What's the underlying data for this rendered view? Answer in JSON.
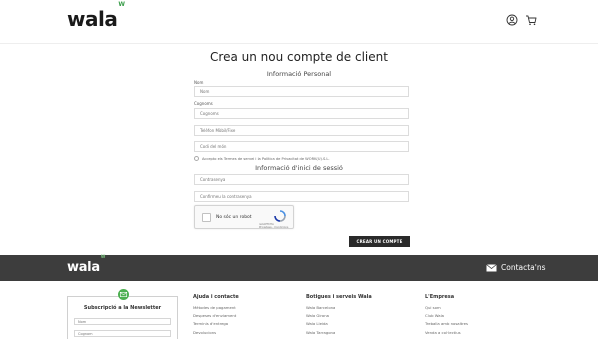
{
  "header": {
    "logo": "wala",
    "logo_mark": "W",
    "user_icon": "user-icon",
    "cart_icon": "cart-icon"
  },
  "form": {
    "title": "Crea un nou compte de client",
    "personal_section": "Informació Personal",
    "nom_label": "Nom",
    "nom_placeholder": "Nom",
    "cognoms_label": "Cognoms",
    "cognoms_placeholder": "Cognoms",
    "phone_placeholder": "Telèfon Mòbil/Fixe",
    "postal_placeholder": "Codi del món",
    "terms_label": "Accepto els Termes de servei i la Política de Privacitat de WORK(U).S.L.",
    "login_section": "Informació d'inici de sessió",
    "password_placeholder": "Contrasenya",
    "confirm_placeholder": "Confirmeu la contrasenya",
    "recaptcha_label": "No sóc un robot",
    "recaptcha_brand": "reCAPTCHA",
    "recaptcha_links": "Privadesa - Condicions",
    "submit_label": "CREAR UN COMPTE"
  },
  "footer": {
    "logo": "wala",
    "logo_mark": "W",
    "contact_label": "Contacta'ns",
    "newsletter": {
      "title": "Subscripció a la Newsletter",
      "name_placeholder": "Nom",
      "email_placeholder": "Cognom"
    },
    "columns": [
      {
        "title": "Ajuda i contacte",
        "links": [
          "Mètodes de pagament",
          "Despeses d'enviament",
          "Terminis d'entrega",
          "Devolucions"
        ]
      },
      {
        "title": "Botigues i serveis Wala",
        "links": [
          "Wala Barcelona",
          "Wala Girona",
          "Wala Lleida",
          "Wala Tarragona"
        ]
      },
      {
        "title": "L'Empresa",
        "links": [
          "Qui som",
          "Club Wala",
          "Treballa amb nosaltres",
          "Venda a col·lectius"
        ]
      }
    ]
  },
  "colors": {
    "accent_green": "#4caf50",
    "dark_button": "#2a2a2a",
    "footer_bar": "#3d3d3d"
  }
}
